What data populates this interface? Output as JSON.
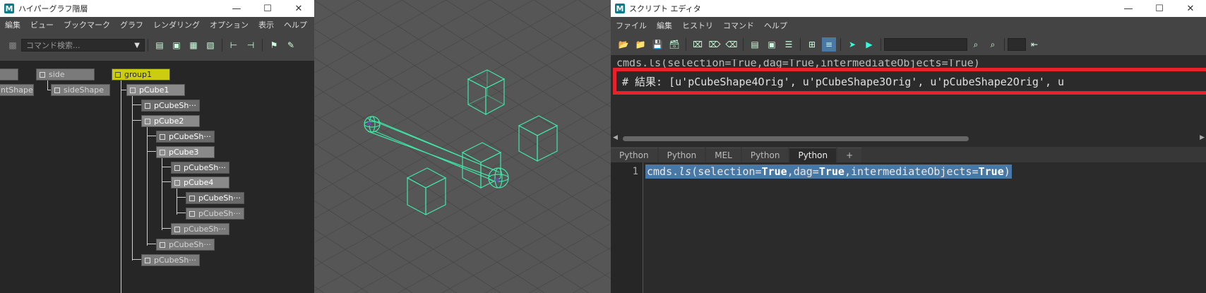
{
  "hypergraph": {
    "title": "ハイパーグラフ階層",
    "menus": [
      "編集",
      "ビュー",
      "ブックマーク",
      "グラフ",
      "レンダリング",
      "オプション",
      "表示",
      "ヘルプ"
    ],
    "search_placeholder": "コマンド検索...",
    "nodes": {
      "side": "side",
      "frontShape": "ntShape",
      "sideShape": "sideShape",
      "group1": "group1",
      "pCube1": "pCube1",
      "pCubeShape1": "pCubeSh···",
      "pCube2": "pCube2",
      "pCubeShape2": "pCubeSh···",
      "pCube3": "pCube3",
      "pCubeShape3": "pCubeSh···",
      "pCube4": "pCube4",
      "pCubeShape4": "pCubeSh···",
      "pCubeShape4Orig": "pCubeSh···",
      "pCubeShape3Orig": "pCubeSh···",
      "pCubeShape2Orig": "pCubeSh···",
      "pCubeShape1Orig": "pCubeSh···"
    }
  },
  "script_editor": {
    "title": "スクリプト エディタ",
    "menus": [
      "ファイル",
      "編集",
      "ヒストリ",
      "コマンド",
      "ヘルプ"
    ],
    "history_line": "cmds.ls(selection=True,dag=True,intermediateObjects=True)",
    "result_line": "# 結果: [u'pCubeShape4Orig', u'pCubeShape3Orig', u'pCubeShape2Orig', u",
    "tabs": [
      "Python",
      "Python",
      "MEL",
      "Python",
      "Python",
      "+"
    ],
    "active_tab": 4,
    "line_number": "1",
    "code": {
      "p1": "cmds.",
      "p2": "ls",
      "p3": "(selection=",
      "p4": "True",
      "p5": ",dag=",
      "p6": "True",
      "p7": ",intermediateObjects=",
      "p8": "True",
      "p9": ")"
    }
  },
  "colors": {
    "selection_node": "#cccc12",
    "result_highlight": "#e8212b",
    "wireframe": "#3fe6a8"
  }
}
